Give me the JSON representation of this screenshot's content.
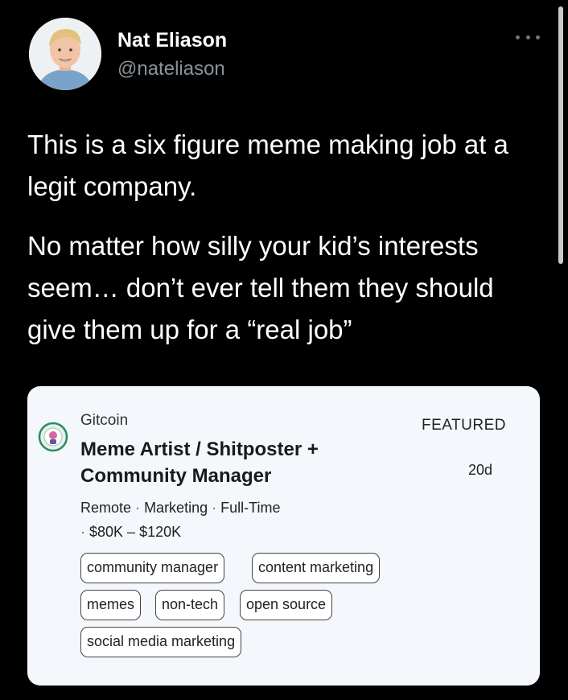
{
  "author": {
    "name": "Nat Eliason",
    "handle": "@nateliason"
  },
  "icons": {
    "more": "more-horizontal-icon",
    "company_logo": "gitcoin-logo"
  },
  "tweet": {
    "paragraph1": "This is a six figure meme making job at a legit company.",
    "paragraph2": "No matter how silly your kid’s interests seem… don’t ever tell them they should  give them up for a “real job”"
  },
  "job_card": {
    "company": "Gitcoin",
    "badge": "FEATURED",
    "posted_ago": "20d",
    "title": "Meme Artist / Shitposter + Community Manager",
    "location": "Remote",
    "category": "Marketing",
    "employment_type": "Full-Time",
    "salary": "$80K – $120K",
    "separator": "·",
    "tags": [
      "community manager",
      "content marketing",
      "memes",
      "non-tech",
      "open source",
      "social media marketing"
    ]
  },
  "colors": {
    "background": "#000000",
    "card_background": "#f4f7fc",
    "handle_gray": "#8b9299"
  }
}
